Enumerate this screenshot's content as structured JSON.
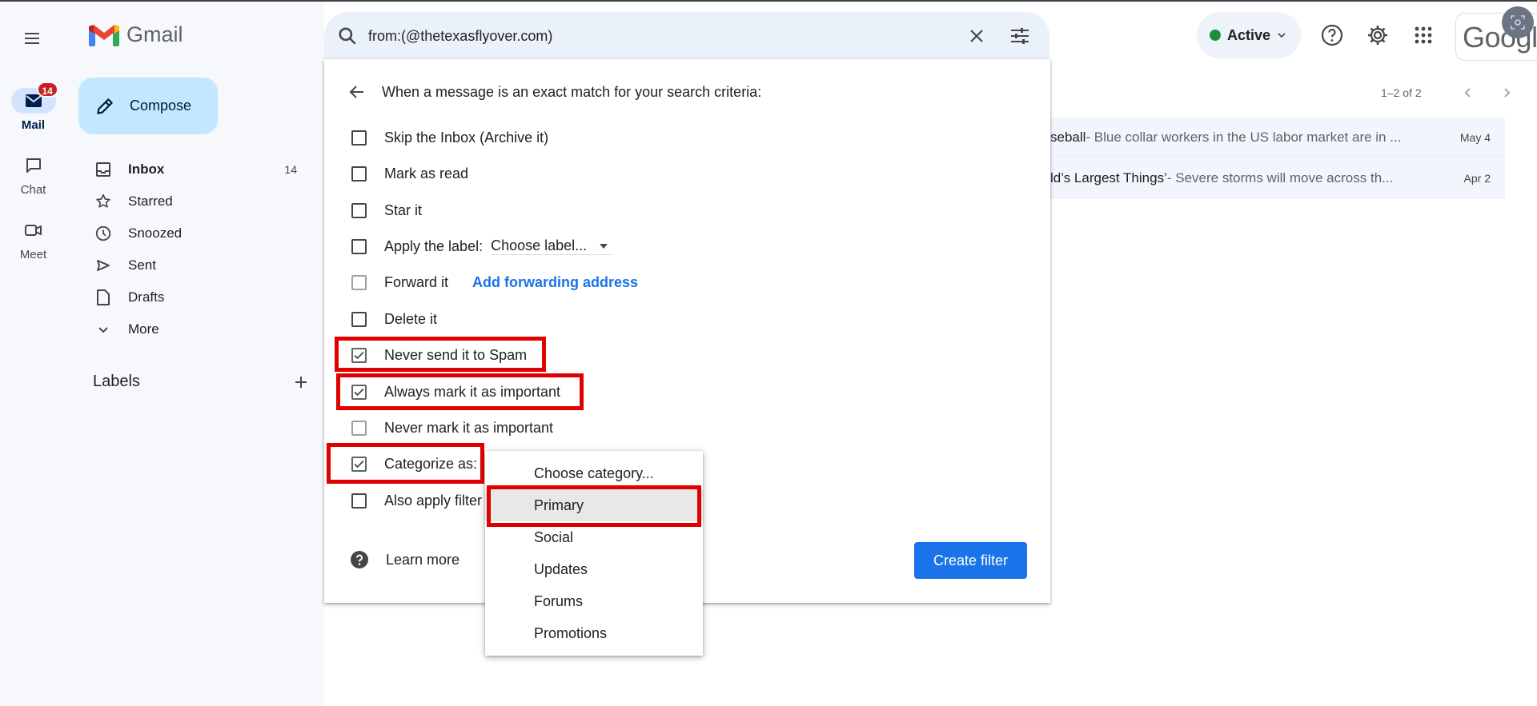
{
  "app": {
    "name": "Gmail"
  },
  "rail": {
    "items": [
      {
        "label": "Mail",
        "badge": "14"
      },
      {
        "label": "Chat"
      },
      {
        "label": "Meet"
      }
    ]
  },
  "sidebar": {
    "compose_label": "Compose",
    "items": [
      {
        "label": "Inbox",
        "count": "14"
      },
      {
        "label": "Starred"
      },
      {
        "label": "Snoozed"
      },
      {
        "label": "Sent"
      },
      {
        "label": "Drafts"
      },
      {
        "label": "More"
      }
    ],
    "labels_heading": "Labels"
  },
  "search": {
    "query": "from:(@thetexasflyover.com)"
  },
  "header": {
    "status": "Active",
    "google_text": "Google"
  },
  "list": {
    "pager": "1–2 of 2",
    "rows": [
      {
        "subject": "seball",
        "snippet": " - Blue collar workers in the US labor market are in ...",
        "date": "May 4"
      },
      {
        "subject": "ld’s Largest Things’",
        "snippet": " - Severe storms will move across th...",
        "date": "Apr 2"
      }
    ]
  },
  "filter": {
    "heading": "When a message is an exact match for your search criteria:",
    "options": [
      {
        "label": "Skip the Inbox (Archive it)",
        "checked": false
      },
      {
        "label": "Mark as read",
        "checked": false
      },
      {
        "label": "Star it",
        "checked": false
      },
      {
        "label": "Apply the label:",
        "checked": false,
        "chooser": "Choose label..."
      },
      {
        "label": "Forward it",
        "checked": false,
        "link": "Add forwarding address"
      },
      {
        "label": "Delete it",
        "checked": false
      },
      {
        "label": "Never send it to Spam",
        "checked": true
      },
      {
        "label": "Always mark it as important",
        "checked": true
      },
      {
        "label": "Never mark it as important",
        "checked": false
      },
      {
        "label": "Categorize as:",
        "checked": true
      },
      {
        "label": "Also apply filter",
        "checked": false
      }
    ],
    "learn_more": "Learn more",
    "create_button": "Create filter"
  },
  "category_dropdown": {
    "selected": "Primary",
    "options": [
      "Choose category...",
      "Primary",
      "Social",
      "Updates",
      "Forums",
      "Promotions"
    ]
  },
  "colors": {
    "accent_blue": "#1a73e8",
    "highlight_red": "#e00000",
    "compose_bg": "#c2e7ff",
    "active_green": "#1e8e3e",
    "badge_red": "#c5221f"
  }
}
